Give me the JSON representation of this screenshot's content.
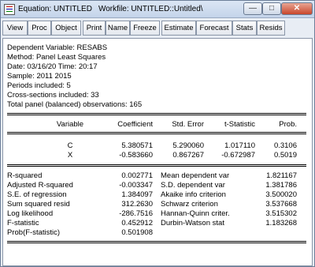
{
  "window": {
    "title": "Equation: UNTITLED",
    "workfile": "Workfile: UNTITLED::Untitled\\",
    "min_glyph": "—",
    "max_glyph": "□",
    "close_glyph": "✕"
  },
  "toolbar": [
    "View",
    "Proc",
    "Object",
    "Print",
    "Name",
    "Freeze",
    "Estimate",
    "Forecast",
    "Stats",
    "Resids"
  ],
  "header_lines": [
    "Dependent Variable: RESABS",
    "Method: Panel Least Squares",
    "Date: 03/16/20   Time: 20:17",
    "Sample: 2011 2015",
    "Periods included: 5",
    "Cross-sections included: 33",
    "Total panel (balanced) observations: 165"
  ],
  "coef_table": {
    "headers": [
      "Variable",
      "Coefficient",
      "Std. Error",
      "t-Statistic",
      "Prob."
    ],
    "rows": [
      [
        "C",
        "5.380571",
        "5.290060",
        "1.017110",
        "0.3106"
      ],
      [
        "X",
        "-0.583660",
        "0.867267",
        "-0.672987",
        "0.5019"
      ]
    ]
  },
  "stats": [
    [
      "R-squared",
      "0.002771",
      "Mean dependent var",
      "1.821167"
    ],
    [
      "Adjusted R-squared",
      "-0.003347",
      "S.D. dependent var",
      "1.381786"
    ],
    [
      "S.E. of regression",
      "1.384097",
      "Akaike info criterion",
      "3.500020"
    ],
    [
      "Sum squared resid",
      "312.2630",
      "Schwarz criterion",
      "3.537668"
    ],
    [
      "Log likelihood",
      "-286.7516",
      "Hannan-Quinn criter.",
      "3.515302"
    ],
    [
      "F-statistic",
      "0.452912",
      "Durbin-Watson stat",
      "1.183268"
    ],
    [
      "Prob(F-statistic)",
      "0.501908",
      "",
      ""
    ]
  ]
}
